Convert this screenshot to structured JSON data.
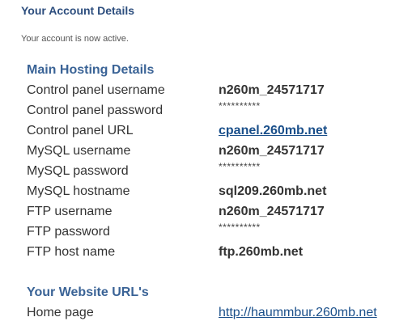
{
  "header": {
    "title": "Your Account Details",
    "status": "Your account is now active."
  },
  "hosting": {
    "heading": "Main Hosting Details",
    "rows": [
      {
        "label": "Control panel username",
        "value": "n260m_24571717"
      },
      {
        "label": "Control panel password",
        "value": "**********"
      },
      {
        "label": "Control panel URL",
        "value": "cpanel.260mb.net"
      },
      {
        "label": "MySQL username",
        "value": "n260m_24571717"
      },
      {
        "label": "MySQL password",
        "value": "**********"
      },
      {
        "label": "MySQL hostname",
        "value": "sql209.260mb.net"
      },
      {
        "label": "FTP username",
        "value": "n260m_24571717"
      },
      {
        "label": "FTP password",
        "value": "**********"
      },
      {
        "label": "FTP host name",
        "value": "ftp.260mb.net"
      }
    ]
  },
  "website": {
    "heading": "Your Website URL's",
    "rows": [
      {
        "label": "Home page",
        "value": "http://haummbur.260mb.net"
      }
    ]
  }
}
